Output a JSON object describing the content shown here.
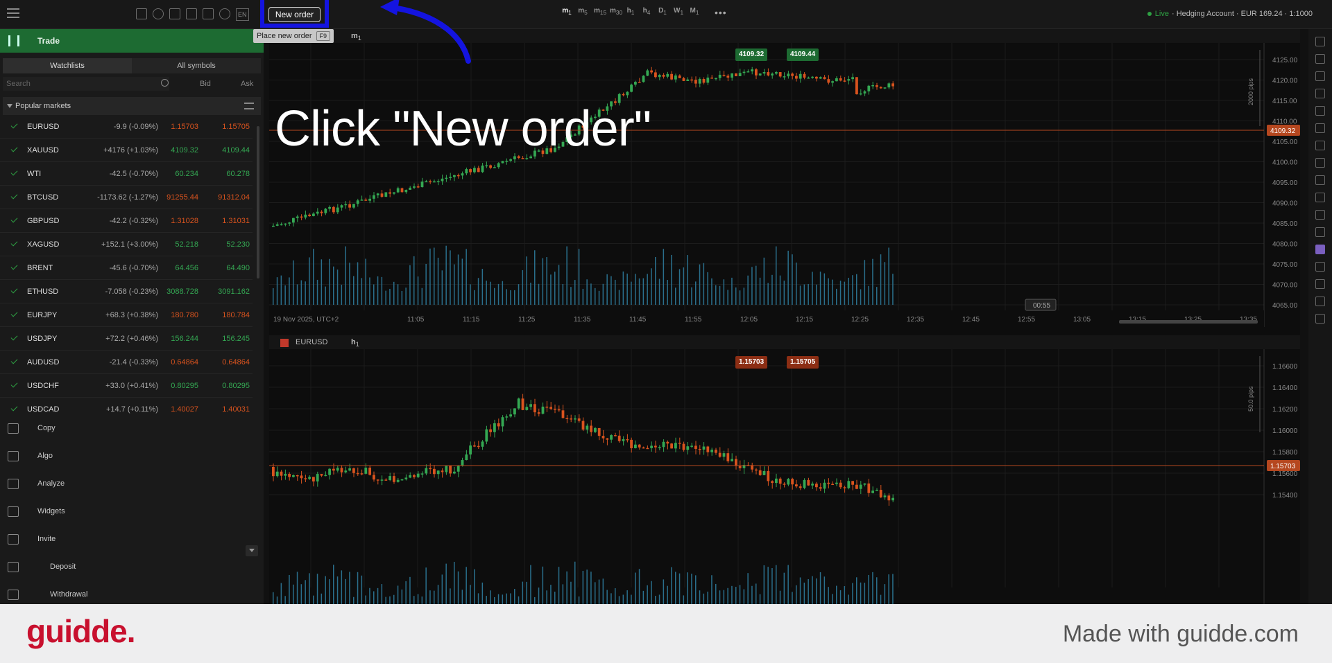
{
  "toolbar": {
    "new_order_label": "New order",
    "tooltip_text": "Place new order",
    "tooltip_shortcut": "F9",
    "lang": "EN",
    "timeframes": [
      {
        "letter": "m",
        "num": "1"
      },
      {
        "letter": "m",
        "num": "5"
      },
      {
        "letter": "m",
        "num": "15"
      },
      {
        "letter": "m",
        "num": "30"
      },
      {
        "letter": "h",
        "num": "1"
      },
      {
        "letter": "h",
        "num": "4"
      },
      {
        "letter": "D",
        "num": "1"
      },
      {
        "letter": "W",
        "num": "1"
      },
      {
        "letter": "M",
        "num": "1"
      }
    ],
    "more": "•••"
  },
  "account": {
    "status": "Live",
    "details": "· Hedging Account · EUR 169.24 · 1:1000"
  },
  "sidebar": {
    "title": "Trade",
    "tabs": [
      "Watchlists",
      "All symbols"
    ],
    "search_placeholder": "Search",
    "col_bid": "Bid",
    "col_ask": "Ask",
    "section": "Popular markets",
    "rows": [
      {
        "sym": "EURUSD",
        "chg": "-9.9 (-0.09%)",
        "bid": "1.15703",
        "ask": "1.15705",
        "dir": "neg"
      },
      {
        "sym": "XAUUSD",
        "chg": "+4176 (+1.03%)",
        "bid": "4109.32",
        "ask": "4109.44",
        "dir": "pos"
      },
      {
        "sym": "WTI",
        "chg": "-42.5 (-0.70%)",
        "bid": "60.234",
        "ask": "60.278",
        "dir": "pos"
      },
      {
        "sym": "BTCUSD",
        "chg": "-1173.62 (-1.27%)",
        "bid": "91255.44",
        "ask": "91312.04",
        "dir": "neg"
      },
      {
        "sym": "GBPUSD",
        "chg": "-42.2 (-0.32%)",
        "bid": "1.31028",
        "ask": "1.31031",
        "dir": "neg"
      },
      {
        "sym": "XAGUSD",
        "chg": "+152.1 (+3.00%)",
        "bid": "52.218",
        "ask": "52.230",
        "dir": "pos"
      },
      {
        "sym": "BRENT",
        "chg": "-45.6 (-0.70%)",
        "bid": "64.456",
        "ask": "64.490",
        "dir": "pos"
      },
      {
        "sym": "ETHUSD",
        "chg": "-7.058 (-0.23%)",
        "bid": "3088.728",
        "ask": "3091.162",
        "dir": "pos"
      },
      {
        "sym": "EURJPY",
        "chg": "+68.3 (+0.38%)",
        "bid": "180.780",
        "ask": "180.784",
        "dir": "neg"
      },
      {
        "sym": "USDJPY",
        "chg": "+72.2 (+0.46%)",
        "bid": "156.244",
        "ask": "156.245",
        "dir": "pos"
      },
      {
        "sym": "AUDUSD",
        "chg": "-21.4 (-0.33%)",
        "bid": "0.64864",
        "ask": "0.64864",
        "dir": "neg"
      },
      {
        "sym": "USDCHF",
        "chg": "+33.0 (+0.41%)",
        "bid": "0.80295",
        "ask": "0.80295",
        "dir": "pos"
      },
      {
        "sym": "USDCAD",
        "chg": "+14.7 (+0.11%)",
        "bid": "1.40027",
        "ask": "1.40031",
        "dir": "neg"
      }
    ],
    "nav": [
      "Copy",
      "Algo",
      "Analyze",
      "Widgets",
      "Invite"
    ],
    "nav2": [
      "Deposit",
      "Withdrawal"
    ]
  },
  "chart_top": {
    "timeframe_letter": "m",
    "timeframe_num": "1",
    "sell": "4109.32",
    "buy": "4109.44",
    "price_label": "4109.32",
    "pips": "2000 pips",
    "date_label": "19 Nov 2025, UTC+2",
    "countdown": "00:55",
    "times": [
      "11:05",
      "11:15",
      "11:25",
      "11:35",
      "11:45",
      "11:55",
      "12:05",
      "12:15",
      "12:25",
      "12:35",
      "12:45",
      "12:55",
      "13:05",
      "13:15",
      "13:25",
      "13:35"
    ],
    "prices": [
      "4125.00",
      "4120.00",
      "4115.00",
      "4110.00",
      "4105.00",
      "4100.00",
      "4095.00",
      "4090.00",
      "4085.00",
      "4080.00",
      "4075.00",
      "4070.00",
      "4065.00"
    ]
  },
  "chart_bottom": {
    "symbol": "EURUSD",
    "timeframe_letter": "h",
    "timeframe_num": "1",
    "sell": "1.15703",
    "buy": "1.15705",
    "price_label": "1.15703",
    "pips": "50.0 pips",
    "prices": [
      "1.16600",
      "1.16400",
      "1.16200",
      "1.16000",
      "1.15800",
      "1.15600",
      "1.15400"
    ]
  },
  "instruction": "Click \"New order\"",
  "footer": {
    "brand": "guidde.",
    "made_with": "Made with guidde.com"
  },
  "colors": {
    "up": "#34a853",
    "down": "#d9531e",
    "accent": "#1d6b32",
    "arrow": "#1414e0"
  }
}
